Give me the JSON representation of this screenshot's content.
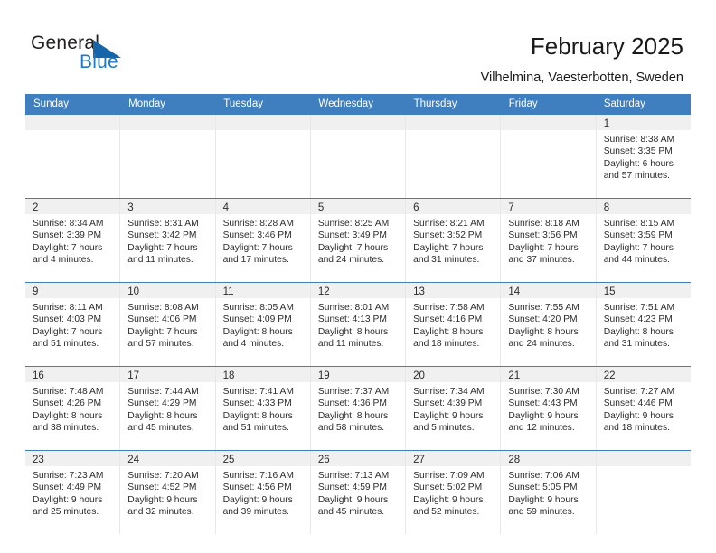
{
  "brand": {
    "name_part1": "General",
    "name_part2": "Blue",
    "accent_color": "#1565a8",
    "text_color": "#231f20"
  },
  "header": {
    "title": "February 2025",
    "subtitle": "Vilhelmina, Vaesterbotten, Sweden"
  },
  "calendar": {
    "header_bg": "#3f7fbf",
    "daynum_bg": "#f0f0f0",
    "weekdays": [
      "Sunday",
      "Monday",
      "Tuesday",
      "Wednesday",
      "Thursday",
      "Friday",
      "Saturday"
    ],
    "weeks": [
      [
        {
          "day": "",
          "sunrise": "",
          "sunset": "",
          "daylight_line1": "",
          "daylight_line2": ""
        },
        {
          "day": "",
          "sunrise": "",
          "sunset": "",
          "daylight_line1": "",
          "daylight_line2": ""
        },
        {
          "day": "",
          "sunrise": "",
          "sunset": "",
          "daylight_line1": "",
          "daylight_line2": ""
        },
        {
          "day": "",
          "sunrise": "",
          "sunset": "",
          "daylight_line1": "",
          "daylight_line2": ""
        },
        {
          "day": "",
          "sunrise": "",
          "sunset": "",
          "daylight_line1": "",
          "daylight_line2": ""
        },
        {
          "day": "",
          "sunrise": "",
          "sunset": "",
          "daylight_line1": "",
          "daylight_line2": ""
        },
        {
          "day": "1",
          "sunrise": "Sunrise: 8:38 AM",
          "sunset": "Sunset: 3:35 PM",
          "daylight_line1": "Daylight: 6 hours",
          "daylight_line2": "and 57 minutes."
        }
      ],
      [
        {
          "day": "2",
          "sunrise": "Sunrise: 8:34 AM",
          "sunset": "Sunset: 3:39 PM",
          "daylight_line1": "Daylight: 7 hours",
          "daylight_line2": "and 4 minutes."
        },
        {
          "day": "3",
          "sunrise": "Sunrise: 8:31 AM",
          "sunset": "Sunset: 3:42 PM",
          "daylight_line1": "Daylight: 7 hours",
          "daylight_line2": "and 11 minutes."
        },
        {
          "day": "4",
          "sunrise": "Sunrise: 8:28 AM",
          "sunset": "Sunset: 3:46 PM",
          "daylight_line1": "Daylight: 7 hours",
          "daylight_line2": "and 17 minutes."
        },
        {
          "day": "5",
          "sunrise": "Sunrise: 8:25 AM",
          "sunset": "Sunset: 3:49 PM",
          "daylight_line1": "Daylight: 7 hours",
          "daylight_line2": "and 24 minutes."
        },
        {
          "day": "6",
          "sunrise": "Sunrise: 8:21 AM",
          "sunset": "Sunset: 3:52 PM",
          "daylight_line1": "Daylight: 7 hours",
          "daylight_line2": "and 31 minutes."
        },
        {
          "day": "7",
          "sunrise": "Sunrise: 8:18 AM",
          "sunset": "Sunset: 3:56 PM",
          "daylight_line1": "Daylight: 7 hours",
          "daylight_line2": "and 37 minutes."
        },
        {
          "day": "8",
          "sunrise": "Sunrise: 8:15 AM",
          "sunset": "Sunset: 3:59 PM",
          "daylight_line1": "Daylight: 7 hours",
          "daylight_line2": "and 44 minutes."
        }
      ],
      [
        {
          "day": "9",
          "sunrise": "Sunrise: 8:11 AM",
          "sunset": "Sunset: 4:03 PM",
          "daylight_line1": "Daylight: 7 hours",
          "daylight_line2": "and 51 minutes."
        },
        {
          "day": "10",
          "sunrise": "Sunrise: 8:08 AM",
          "sunset": "Sunset: 4:06 PM",
          "daylight_line1": "Daylight: 7 hours",
          "daylight_line2": "and 57 minutes."
        },
        {
          "day": "11",
          "sunrise": "Sunrise: 8:05 AM",
          "sunset": "Sunset: 4:09 PM",
          "daylight_line1": "Daylight: 8 hours",
          "daylight_line2": "and 4 minutes."
        },
        {
          "day": "12",
          "sunrise": "Sunrise: 8:01 AM",
          "sunset": "Sunset: 4:13 PM",
          "daylight_line1": "Daylight: 8 hours",
          "daylight_line2": "and 11 minutes."
        },
        {
          "day": "13",
          "sunrise": "Sunrise: 7:58 AM",
          "sunset": "Sunset: 4:16 PM",
          "daylight_line1": "Daylight: 8 hours",
          "daylight_line2": "and 18 minutes."
        },
        {
          "day": "14",
          "sunrise": "Sunrise: 7:55 AM",
          "sunset": "Sunset: 4:20 PM",
          "daylight_line1": "Daylight: 8 hours",
          "daylight_line2": "and 24 minutes."
        },
        {
          "day": "15",
          "sunrise": "Sunrise: 7:51 AM",
          "sunset": "Sunset: 4:23 PM",
          "daylight_line1": "Daylight: 8 hours",
          "daylight_line2": "and 31 minutes."
        }
      ],
      [
        {
          "day": "16",
          "sunrise": "Sunrise: 7:48 AM",
          "sunset": "Sunset: 4:26 PM",
          "daylight_line1": "Daylight: 8 hours",
          "daylight_line2": "and 38 minutes."
        },
        {
          "day": "17",
          "sunrise": "Sunrise: 7:44 AM",
          "sunset": "Sunset: 4:29 PM",
          "daylight_line1": "Daylight: 8 hours",
          "daylight_line2": "and 45 minutes."
        },
        {
          "day": "18",
          "sunrise": "Sunrise: 7:41 AM",
          "sunset": "Sunset: 4:33 PM",
          "daylight_line1": "Daylight: 8 hours",
          "daylight_line2": "and 51 minutes."
        },
        {
          "day": "19",
          "sunrise": "Sunrise: 7:37 AM",
          "sunset": "Sunset: 4:36 PM",
          "daylight_line1": "Daylight: 8 hours",
          "daylight_line2": "and 58 minutes."
        },
        {
          "day": "20",
          "sunrise": "Sunrise: 7:34 AM",
          "sunset": "Sunset: 4:39 PM",
          "daylight_line1": "Daylight: 9 hours",
          "daylight_line2": "and 5 minutes."
        },
        {
          "day": "21",
          "sunrise": "Sunrise: 7:30 AM",
          "sunset": "Sunset: 4:43 PM",
          "daylight_line1": "Daylight: 9 hours",
          "daylight_line2": "and 12 minutes."
        },
        {
          "day": "22",
          "sunrise": "Sunrise: 7:27 AM",
          "sunset": "Sunset: 4:46 PM",
          "daylight_line1": "Daylight: 9 hours",
          "daylight_line2": "and 18 minutes."
        }
      ],
      [
        {
          "day": "23",
          "sunrise": "Sunrise: 7:23 AM",
          "sunset": "Sunset: 4:49 PM",
          "daylight_line1": "Daylight: 9 hours",
          "daylight_line2": "and 25 minutes."
        },
        {
          "day": "24",
          "sunrise": "Sunrise: 7:20 AM",
          "sunset": "Sunset: 4:52 PM",
          "daylight_line1": "Daylight: 9 hours",
          "daylight_line2": "and 32 minutes."
        },
        {
          "day": "25",
          "sunrise": "Sunrise: 7:16 AM",
          "sunset": "Sunset: 4:56 PM",
          "daylight_line1": "Daylight: 9 hours",
          "daylight_line2": "and 39 minutes."
        },
        {
          "day": "26",
          "sunrise": "Sunrise: 7:13 AM",
          "sunset": "Sunset: 4:59 PM",
          "daylight_line1": "Daylight: 9 hours",
          "daylight_line2": "and 45 minutes."
        },
        {
          "day": "27",
          "sunrise": "Sunrise: 7:09 AM",
          "sunset": "Sunset: 5:02 PM",
          "daylight_line1": "Daylight: 9 hours",
          "daylight_line2": "and 52 minutes."
        },
        {
          "day": "28",
          "sunrise": "Sunrise: 7:06 AM",
          "sunset": "Sunset: 5:05 PM",
          "daylight_line1": "Daylight: 9 hours",
          "daylight_line2": "and 59 minutes."
        },
        {
          "day": "",
          "sunrise": "",
          "sunset": "",
          "daylight_line1": "",
          "daylight_line2": ""
        }
      ]
    ]
  }
}
